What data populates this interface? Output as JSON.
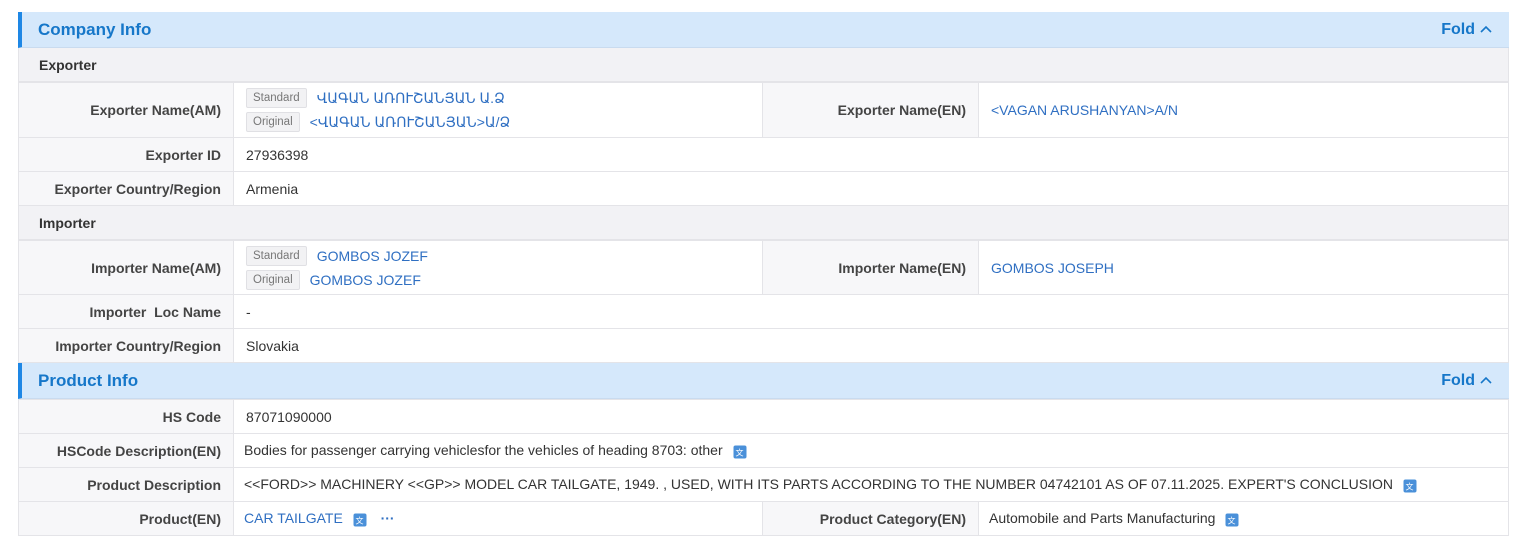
{
  "company": {
    "title": "Company Info",
    "fold_label": "Fold",
    "exporter": {
      "group_label": "Exporter",
      "name_am_label": "Exporter Name(AM)",
      "standard_tag": "Standard",
      "original_tag": "Original",
      "name_am_standard": "ՎԱԳԱՆ ԱՌՈՒՇԱՆՅԱՆ Ա.Ձ",
      "name_am_original": "<ՎԱԳԱՆ ԱՌՈՒՇԱՆՅԱՆ>Ա/Ձ",
      "name_en_label": "Exporter Name(EN)",
      "name_en": "<VAGAN ARUSHANYAN>A/N",
      "id_label": "Exporter ID",
      "id": "27936398",
      "country_label": "Exporter Country/Region",
      "country": "Armenia"
    },
    "importer": {
      "group_label": "Importer",
      "name_am_label": "Importer Name(AM)",
      "standard_tag": "Standard",
      "original_tag": "Original",
      "name_am_standard": "GOMBOS JOZEF",
      "name_am_original": "GOMBOS JOZEF",
      "name_en_label": "Importer Name(EN)",
      "name_en": "GOMBOS JOSEPH",
      "loc_name_label": "Importer  Loc Name",
      "loc_name": "-",
      "country_label": "Importer Country/Region",
      "country": "Slovakia"
    }
  },
  "product": {
    "title": "Product Info",
    "fold_label": "Fold",
    "hs_code_label": "HS Code",
    "hs_code": "87071090000",
    "hs_desc_label": "HSCode Description(EN)",
    "hs_desc": "Bodies for passenger carrying vehiclesfor the vehicles of heading 8703: other",
    "desc_label": "Product Description",
    "desc": "<<FORD>> MACHINERY <<GP>> MODEL CAR TAILGATE, 1949. , USED, WITH ITS PARTS ACCORDING TO THE NUMBER 04742101 AS OF 07.11.2025. EXPERT'S CONCLUSION",
    "product_en_label": "Product(EN)",
    "product_en": "CAR TAILGATE",
    "more": "···",
    "category_label": "Product Category(EN)",
    "category": "Automobile and Parts Manufacturing"
  },
  "colors": {
    "accent": "#1677c9",
    "header_bg": "#d5e8fb",
    "link": "#2f6fc2"
  },
  "icons": [
    "chevron-up-icon",
    "translate-icon"
  ]
}
